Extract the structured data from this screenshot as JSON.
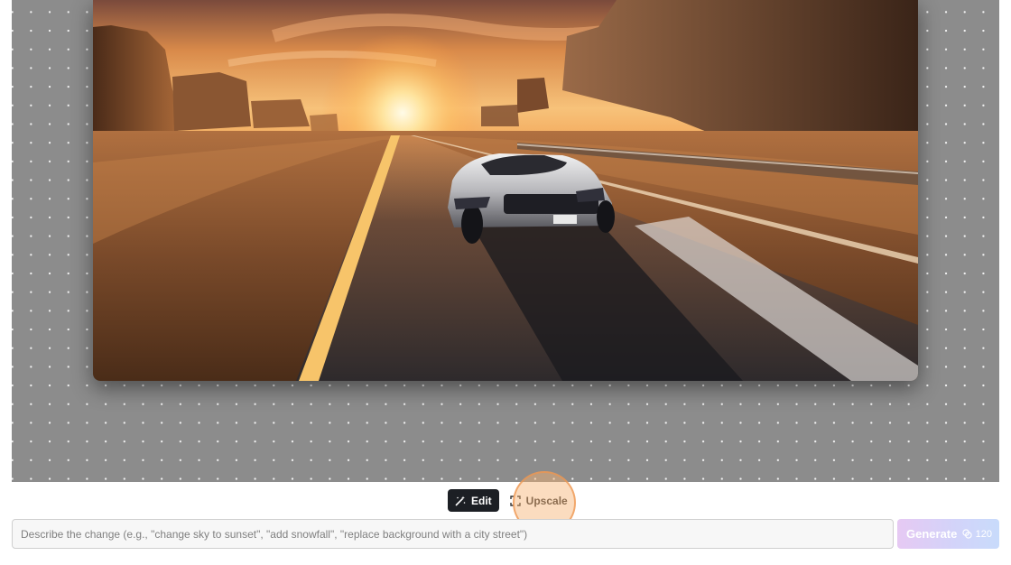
{
  "toolbar": {
    "edit_label": "Edit",
    "upscale_label": "Upscale",
    "active_mode": "edit"
  },
  "prompt": {
    "value": "",
    "placeholder": "Describe the change (e.g., \"change sky to sunset\", \"add snowfall\", \"replace background with a city street\")"
  },
  "generate": {
    "label": "Generate",
    "credits": "120",
    "credits_icon": "coins-icon"
  },
  "colors": {
    "canvas_bg": "#8c8c8c",
    "active_button": "#1c1f24",
    "generate_gradient_start": "#e6c9f3",
    "generate_gradient_end": "#c8dbfb",
    "cursor_highlight": "#f0a060"
  },
  "image": {
    "icon": "generated-image"
  }
}
